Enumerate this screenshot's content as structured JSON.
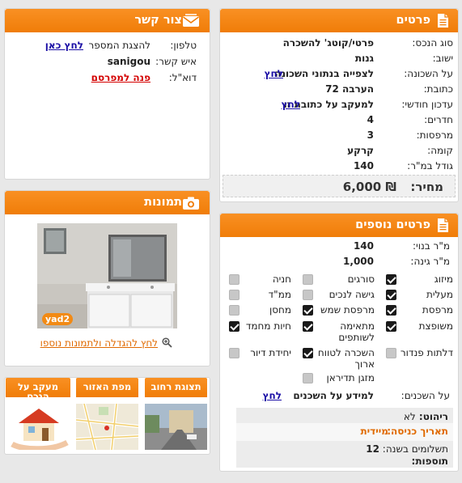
{
  "details": {
    "title": "פרטים",
    "rows": [
      {
        "label": "סוג הנכס:",
        "value": "פרטי/קוטג' להשכרה",
        "link": ""
      },
      {
        "label": "ישוב:",
        "value": "גנות",
        "link": ""
      },
      {
        "label": "על השכונה:",
        "value": "לצפייה בנתוני השכונה",
        "link": "לחץ"
      },
      {
        "label": "כתובת:",
        "value": "הערבה 72",
        "link": ""
      },
      {
        "label": "עדכון חודשי:",
        "value": "למעקב על כתובת זו",
        "link": "לחץ"
      },
      {
        "label": "חדרים:",
        "value": "4",
        "link": ""
      },
      {
        "label": "מרפסות:",
        "value": "3",
        "link": ""
      },
      {
        "label": "קומה:",
        "value": "קרקע",
        "link": ""
      },
      {
        "label": "גודל במ\"ר:",
        "value": "140",
        "link": ""
      }
    ],
    "price_label": "מחיר:",
    "price_value": "6,000 ₪"
  },
  "contact": {
    "title": "צור קשר",
    "phone_label": "טלפון:",
    "phone_text": "להצגת המספר",
    "phone_link": "לחץ כאן",
    "person_label": "איש קשר:",
    "person_value": "sanigou",
    "email_label": "דוא\"ל:",
    "email_link": "פנה למפרסם"
  },
  "photos": {
    "title": "תמונות",
    "watermark": "yad2",
    "enlarge_link": "לחץ להגדלה ולתמונות נוספו"
  },
  "more": {
    "title": "פרטים נוספים",
    "built_label": "מ\"ר בנוי:",
    "built_value": "140",
    "garden_label": "מ\"ר גינה:",
    "garden_value": "1,000",
    "features": [
      {
        "label": "מיזוג",
        "checked": true
      },
      {
        "label": "סורגים",
        "checked": false
      },
      {
        "label": "חניה",
        "checked": false
      },
      {
        "label": "מעלית",
        "checked": true
      },
      {
        "label": "גישה לנכים",
        "checked": false
      },
      {
        "label": "ממ\"ד",
        "checked": false
      },
      {
        "label": "מרפסת",
        "checked": true
      },
      {
        "label": "מרפסת שמש",
        "checked": true
      },
      {
        "label": "מחסן",
        "checked": false
      },
      {
        "label": "משופצת",
        "checked": true
      },
      {
        "label": "מתאימה לשותפים",
        "checked": true
      },
      {
        "label": "חיות מחמד",
        "checked": true
      },
      {
        "label": "דלתות פנדור",
        "checked": false
      },
      {
        "label": "השכרה לטווח ארוך",
        "checked": true
      },
      {
        "label": "יחידת דיור",
        "checked": false
      },
      {
        "label": "מזגן תדיראן",
        "checked": false
      }
    ],
    "neighbors_label": "על השכנים:",
    "neighbors_value": "למידע על השכנים",
    "neighbors_link": "לחץ",
    "furniture_label": "ריהוט:",
    "furniture_value": "לא",
    "entry_label": "תאריך כניסה:",
    "entry_value": "מיידית",
    "payments_label": "תשלומים בשנה:",
    "payments_value": "12",
    "extras_label": "תוספות:"
  },
  "mini": {
    "street_view": "תצוגת רחוב",
    "area_map": "מפת האזור",
    "follow": "מעקב על הנכס"
  },
  "colors": {
    "accent": "#f28a14",
    "link": "#1a0ea5",
    "red_link": "#d40000"
  }
}
